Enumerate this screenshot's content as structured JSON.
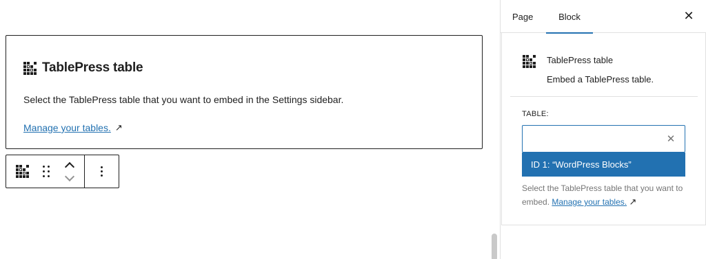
{
  "editor": {
    "block": {
      "title": "TablePress table",
      "description": "Select the TablePress table that you want to embed in the Settings sidebar.",
      "manage_link": "Manage your tables.",
      "external_arrow": "↗"
    },
    "toolbar": {
      "icons": [
        "tablepress-icon",
        "drag-handle-icon",
        "move-up-icon",
        "move-down-icon",
        "more-options-icon"
      ]
    }
  },
  "sidebar": {
    "tabs": [
      {
        "label": "Page",
        "active": false
      },
      {
        "label": "Block",
        "active": true
      }
    ],
    "close_glyph": "✕",
    "block_card": {
      "title": "TablePress table",
      "description": "Embed a TablePress table."
    },
    "table_field": {
      "label": "TABLE:",
      "value": "",
      "clear_glyph": "✕",
      "suggestion": "ID 1: “WordPress Blocks”",
      "help_text": "Select the TablePress table that you want to embed.",
      "help_link": "Manage your tables.",
      "external_arrow": "↗"
    }
  },
  "colors": {
    "accent": "#2271b1",
    "text": "#1e1e1e",
    "muted": "#757575",
    "border": "#e0e0e0"
  }
}
